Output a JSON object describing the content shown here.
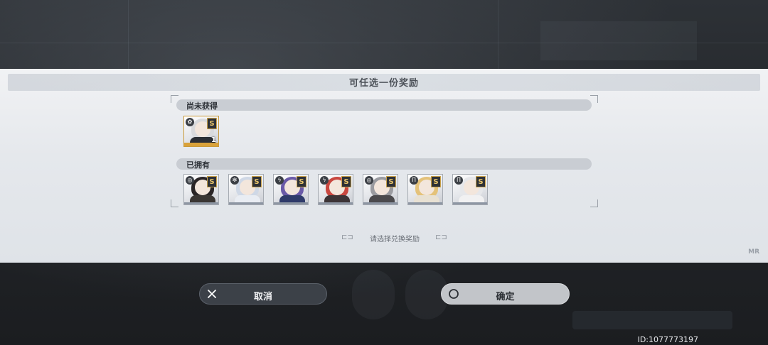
{
  "dialog": {
    "title": "可任选一份奖励",
    "section_unowned": "尚未获得",
    "section_owned": "已拥有",
    "prompt": "请选择兑换奖励"
  },
  "unowned_items": [
    {
      "rank": "S",
      "element_icon": "flower-icon",
      "count": "1",
      "hair": "#d9dadd",
      "outfit": "#2c2f35"
    }
  ],
  "owned_items": [
    {
      "rank": "S",
      "element_icon": "swirl-icon",
      "hair": "#2a2526",
      "outfit": "#3a3633"
    },
    {
      "rank": "S",
      "element_icon": "snowflake-icon",
      "hair": "#cfd8e6",
      "outfit": "#e9edf3"
    },
    {
      "rank": "S",
      "element_icon": "lightning-icon",
      "hair": "#6a5aa8",
      "outfit": "#2f3b6a"
    },
    {
      "rank": "S",
      "element_icon": "lightning-icon",
      "hair": "#c9473f",
      "outfit": "#3c3436"
    },
    {
      "rank": "S",
      "element_icon": "swirl-icon",
      "hair": "#9a9ba0",
      "outfit": "#4b4a4d"
    },
    {
      "rank": "S",
      "element_icon": "pillar-icon",
      "hair": "#e4c27a",
      "outfit": "#e8e1d3"
    },
    {
      "rank": "S",
      "element_icon": "pillar-icon",
      "hair": "#e6e7ea",
      "outfit": "#f1f1f2"
    }
  ],
  "buttons": {
    "cancel": "取消",
    "confirm": "确定"
  },
  "footer": {
    "user_id": "ID:1077773197",
    "logo": "MR"
  },
  "colors": {
    "featured_border": "#c99a3a",
    "rank_gold": "#e8c46a"
  }
}
